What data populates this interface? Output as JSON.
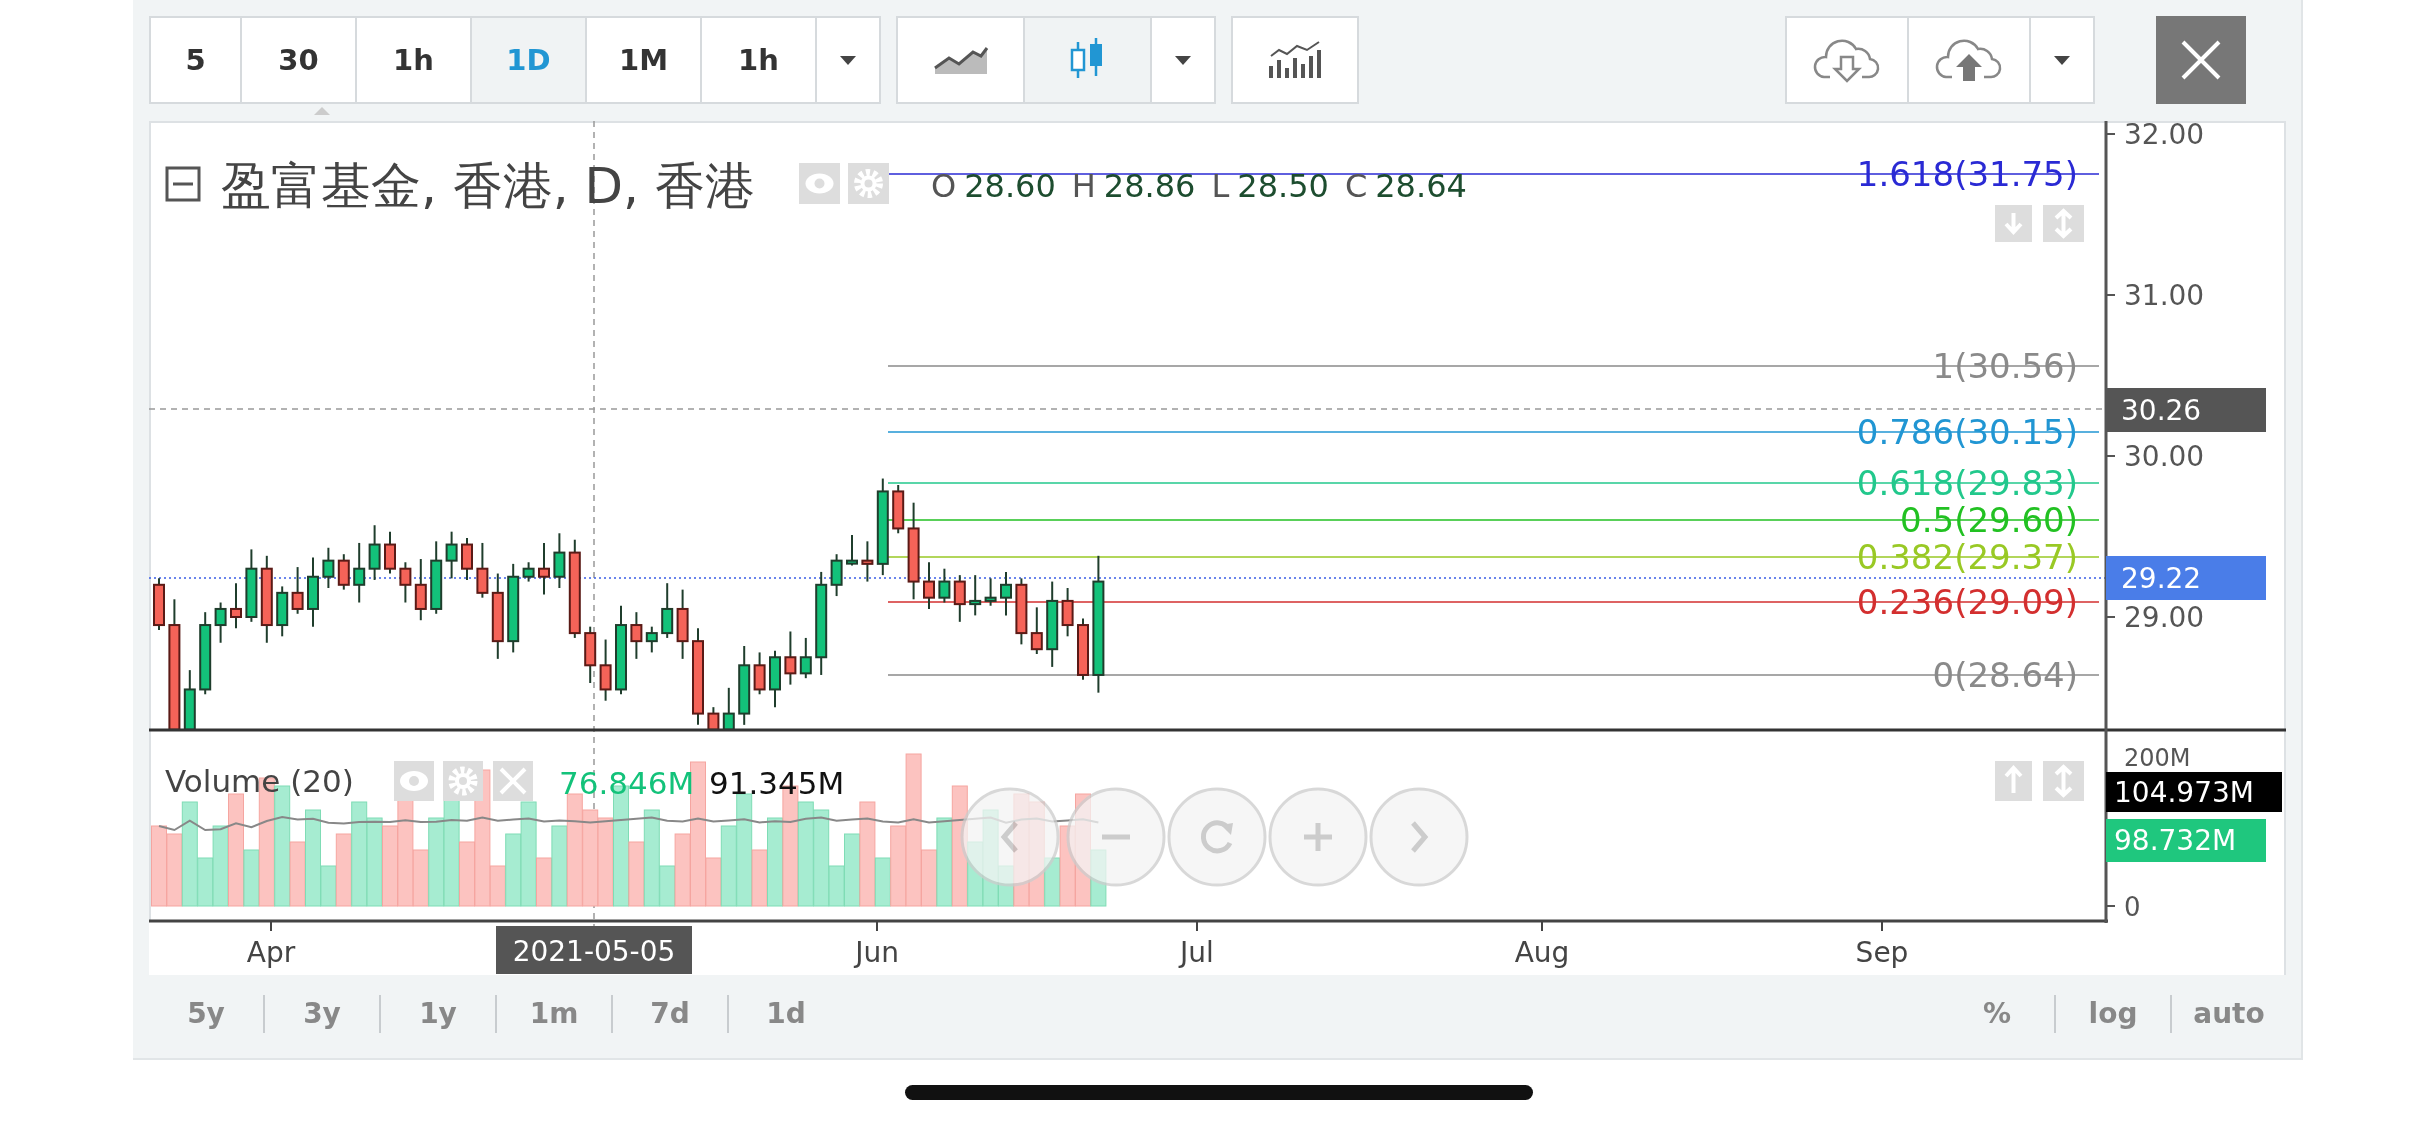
{
  "toolbar": {
    "intervals": [
      {
        "label": "5",
        "selected": false
      },
      {
        "label": "30",
        "selected": false
      },
      {
        "label": "1h",
        "selected": false
      },
      {
        "label": "1D",
        "selected": true
      },
      {
        "label": "1M",
        "selected": false
      },
      {
        "label": "1h",
        "selected": false
      }
    ],
    "chart_types": [
      {
        "kind": "line",
        "selected": false
      },
      {
        "kind": "candles",
        "selected": true
      }
    ]
  },
  "legend": {
    "title": "盈富基金, 香港, D, 香港",
    "ohlc": [
      {
        "label": "O",
        "value": "28.60"
      },
      {
        "label": "H",
        "value": "28.86"
      },
      {
        "label": "L",
        "value": "28.50"
      },
      {
        "label": "C",
        "value": "28.64"
      }
    ]
  },
  "fib_levels": [
    {
      "label": "1.618(31.75)",
      "color": "#2a2ad4"
    },
    {
      "label": "1(30.56)",
      "color": "#8a8a8a"
    },
    {
      "label": "0.786(30.15)",
      "color": "#2196d3"
    },
    {
      "label": "0.618(29.83)",
      "color": "#22c88c"
    },
    {
      "label": "0.5(29.60)",
      "color": "#22c122"
    },
    {
      "label": "0.382(29.37)",
      "color": "#99c925"
    },
    {
      "label": "0.236(29.09)",
      "color": "#d32f2f"
    },
    {
      "label": "0(28.64)",
      "color": "#8a8a8a"
    }
  ],
  "price_axis": {
    "ticks": [
      "32.00",
      "31.00",
      "30.00",
      "29.00"
    ],
    "crosshair_price": "30.26",
    "last_price": "29.22"
  },
  "volume": {
    "title": "Volume (20)",
    "value": "76.846M",
    "ma_value": "91.345M",
    "axis_ticks": [
      "200M",
      "0"
    ],
    "ma_badge": "104.973M",
    "value_badge": "98.732M"
  },
  "time_axis": {
    "labels": [
      "Apr",
      "Jun",
      "Jul",
      "Aug",
      "Sep"
    ],
    "crosshair_date": "2021-05-05"
  },
  "ranges": [
    "5y",
    "3y",
    "1y",
    "1m",
    "7d",
    "1d"
  ],
  "scale_options": [
    "%",
    "log",
    "auto"
  ]
}
